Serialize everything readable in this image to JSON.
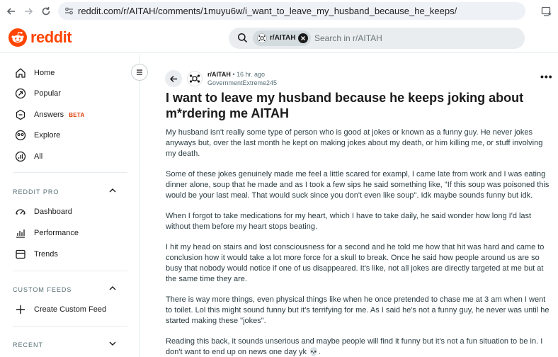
{
  "browser": {
    "url": "reddit.com/r/AITAH/comments/1muyu6w/i_want_to_leave_my_husband_because_he_keeps/"
  },
  "header": {
    "logo_text": "reddit",
    "search_chip": "r/AITAH",
    "search_placeholder": "Search in r/AITAH"
  },
  "sidebar": {
    "items": [
      {
        "label": "Home",
        "icon": "home-icon"
      },
      {
        "label": "Popular",
        "icon": "popular-icon"
      },
      {
        "label": "Answers",
        "icon": "answers-icon",
        "badge": "BETA"
      },
      {
        "label": "Explore",
        "icon": "explore-icon"
      },
      {
        "label": "All",
        "icon": "all-icon"
      }
    ],
    "reddit_pro": {
      "title": "REDDIT PRO",
      "items": [
        {
          "label": "Dashboard",
          "icon": "dashboard-icon"
        },
        {
          "label": "Performance",
          "icon": "performance-icon"
        },
        {
          "label": "Trends",
          "icon": "trends-icon"
        }
      ]
    },
    "custom_feeds": {
      "title": "CUSTOM FEEDS",
      "create_label": "Create Custom Feed"
    },
    "recent": {
      "title": "RECENT"
    }
  },
  "post": {
    "subreddit": "r/AITAH",
    "time": "• 16 hr. ago",
    "author": "GovernmentExtreme245",
    "title": "I want to leave my husband because he keeps joking about m*rdering me AITAH",
    "paragraphs": [
      "My husband isn't really some type of person who is good at jokes or known as a funny guy. He never jokes anyways but, over the last month he kept on making jokes about my death, or him killing me, or stuff involving my death.",
      "Some of these jokes genuinely made me feel a little scared for exampl, I came late from work and I was eating dinner alone, soup that he made and as I took a few sips he said something like, \"If this soup was poisoned this would be your last meal. That would suck since you don't even like soup\". Idk maybe sounds funny but idk.",
      "When I forgot to take medications for my heart, which I have to take daily, he said wonder how long I'd last without them before my heart stops beating.",
      "I hit my head on stairs and lost consciousness for a second and he told me how that hit was hard and came to conclusion how it would take a lot more force for a skull to break. Once he said how people around us are so busy that nobody would notice if one of us disappeared. It's like, not all jokes are directly targeted at me but at the same time they are.",
      "There is way more things, even physical things like when he once pretended to chase me at 3 am when I went to toilet. Lol this might sound funny but it's terrifying for me. As I said he's not a funny guy, he never was until he started making these \"jokes\".",
      "Reading this back, it sounds unserious and maybe people will find it funny but it's not a fun situation to be in. I don't want to end up on news one day yk 💀."
    ]
  },
  "colors": {
    "brand": "#ff4500",
    "beta": "#d93900"
  }
}
